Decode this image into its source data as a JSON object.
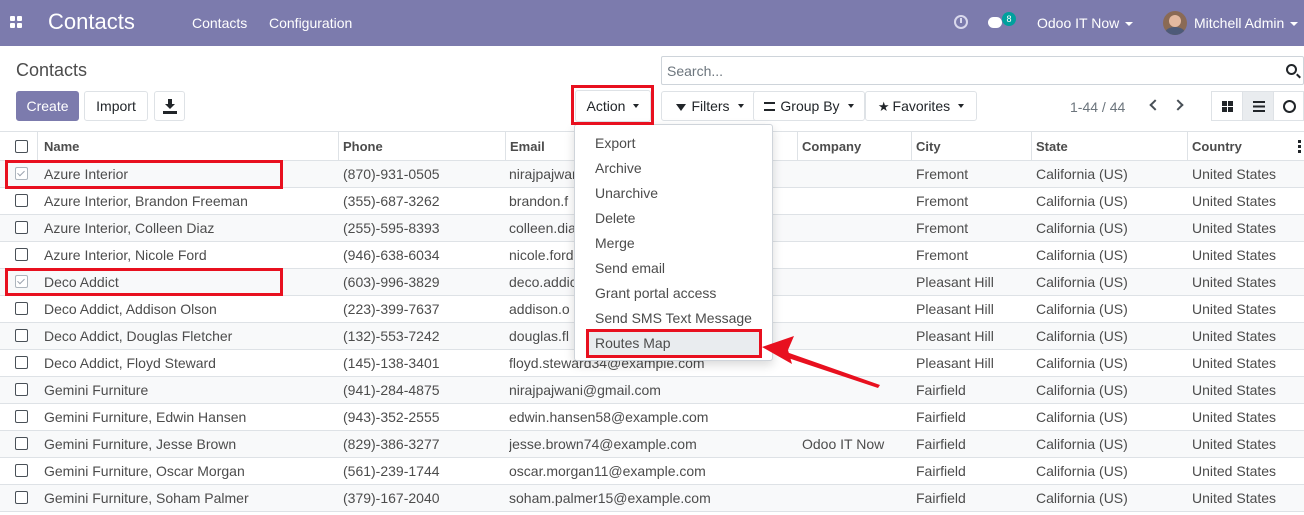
{
  "navbar": {
    "app_title": "Contacts",
    "menu": [
      "Contacts",
      "Configuration"
    ],
    "messages_count": "8",
    "company": "Odoo IT Now",
    "user": "Mitchell Admin",
    "icons": [
      "apps-icon",
      "clock-icon",
      "chat-icon",
      "avatar"
    ]
  },
  "control_panel": {
    "breadcrumb": "Contacts",
    "create_label": "Create",
    "import_label": "Import",
    "action_label": "Action",
    "filters_label": "Filters",
    "group_by_label": "Group By",
    "favorites_label": "Favorites",
    "search_placeholder": "Search...",
    "pager": "1-44 / 44"
  },
  "table": {
    "columns": [
      "Name",
      "Phone",
      "Email",
      "Company",
      "City",
      "State",
      "Country"
    ],
    "rows": [
      {
        "checked": true,
        "name": "Azure Interior",
        "phone": "(870)-931-0505",
        "email": "nirajpajwani",
        "company": "",
        "city": "Fremont",
        "state": "California (US)",
        "country": "United States"
      },
      {
        "checked": false,
        "name": "Azure Interior, Brandon Freeman",
        "phone": "(355)-687-3262",
        "email": "brandon.f",
        "company": "",
        "city": "Fremont",
        "state": "California (US)",
        "country": "United States"
      },
      {
        "checked": false,
        "name": "Azure Interior, Colleen Diaz",
        "phone": "(255)-595-8393",
        "email": "colleen.dia",
        "company": "",
        "city": "Fremont",
        "state": "California (US)",
        "country": "United States"
      },
      {
        "checked": false,
        "name": "Azure Interior, Nicole Ford",
        "phone": "(946)-638-6034",
        "email": "nicole.ford",
        "company": "",
        "city": "Fremont",
        "state": "California (US)",
        "country": "United States"
      },
      {
        "checked": true,
        "name": "Deco Addict",
        "phone": "(603)-996-3829",
        "email": "deco.addic",
        "company": "",
        "city": "Pleasant Hill",
        "state": "California (US)",
        "country": "United States"
      },
      {
        "checked": false,
        "name": "Deco Addict, Addison Olson",
        "phone": "(223)-399-7637",
        "email": "addison.o",
        "company": "",
        "city": "Pleasant Hill",
        "state": "California (US)",
        "country": "United States"
      },
      {
        "checked": false,
        "name": "Deco Addict, Douglas Fletcher",
        "phone": "(132)-553-7242",
        "email": "douglas.fl",
        "company": "",
        "city": "Pleasant Hill",
        "state": "California (US)",
        "country": "United States"
      },
      {
        "checked": false,
        "name": "Deco Addict, Floyd Steward",
        "phone": "(145)-138-3401",
        "email": "floyd.steward34@example.com",
        "company": "",
        "city": "Pleasant Hill",
        "state": "California (US)",
        "country": "United States"
      },
      {
        "checked": false,
        "name": "Gemini Furniture",
        "phone": "(941)-284-4875",
        "email": "nirajpajwani@gmail.com",
        "company": "",
        "city": "Fairfield",
        "state": "California (US)",
        "country": "United States"
      },
      {
        "checked": false,
        "name": "Gemini Furniture, Edwin Hansen",
        "phone": "(943)-352-2555",
        "email": "edwin.hansen58@example.com",
        "company": "",
        "city": "Fairfield",
        "state": "California (US)",
        "country": "United States"
      },
      {
        "checked": false,
        "name": "Gemini Furniture, Jesse Brown",
        "phone": "(829)-386-3277",
        "email": "jesse.brown74@example.com",
        "company": "Odoo IT Now",
        "city": "Fairfield",
        "state": "California (US)",
        "country": "United States"
      },
      {
        "checked": false,
        "name": "Gemini Furniture, Oscar Morgan",
        "phone": "(561)-239-1744",
        "email": "oscar.morgan11@example.com",
        "company": "",
        "city": "Fairfield",
        "state": "California (US)",
        "country": "United States"
      },
      {
        "checked": false,
        "name": "Gemini Furniture, Soham Palmer",
        "phone": "(379)-167-2040",
        "email": "soham.palmer15@example.com",
        "company": "",
        "city": "Fairfield",
        "state": "California (US)",
        "country": "United States"
      }
    ]
  },
  "action_menu": {
    "items": [
      "Export",
      "Archive",
      "Unarchive",
      "Delete",
      "Merge",
      "Send email",
      "Grant portal access",
      "Send SMS Text Message",
      "Routes Map"
    ],
    "highlighted": "Routes Map"
  },
  "colors": {
    "brand": "#7c7bad",
    "annotation": "#e8101f",
    "badge": "#00a09d"
  }
}
